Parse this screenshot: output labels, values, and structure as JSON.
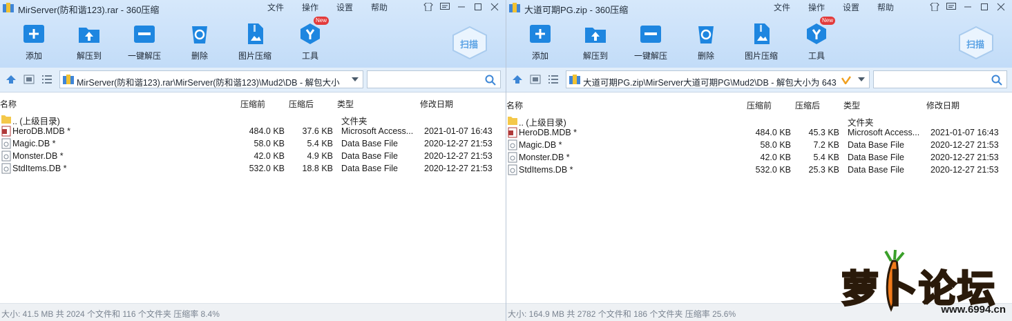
{
  "left": {
    "title": "MirServer(防和谐123).rar - 360压缩",
    "menu": [
      "文件",
      "操作",
      "设置",
      "帮助"
    ],
    "toolbar": {
      "add": "添加",
      "extract_to": "解压到",
      "one_click": "一键解压",
      "delete": "删除",
      "image_compress": "图片压缩",
      "tools": "工具",
      "new_badge": "New",
      "scan": "扫描"
    },
    "path": "MirServer(防和谐123).rar\\MirServer(防和谐123)\\Mud2\\DB - 解包大小",
    "columns": {
      "name": "名称",
      "before": "压缩前",
      "after": "压缩后",
      "type": "类型",
      "modified": "修改日期"
    },
    "parent": {
      "name": ".. (上级目录)",
      "type": "文件夹"
    },
    "files": [
      {
        "name": "HeroDB.MDB *",
        "before": "484.0 KB",
        "after": "37.6 KB",
        "type": "Microsoft Access...",
        "modified": "2021-01-07 16:43"
      },
      {
        "name": "Magic.DB *",
        "before": "58.0 KB",
        "after": "5.4 KB",
        "type": "Data Base File",
        "modified": "2020-12-27 21:53"
      },
      {
        "name": "Monster.DB *",
        "before": "42.0 KB",
        "after": "4.9 KB",
        "type": "Data Base File",
        "modified": "2020-12-27 21:53"
      },
      {
        "name": "StdItems.DB *",
        "before": "532.0 KB",
        "after": "18.8 KB",
        "type": "Data Base File",
        "modified": "2020-12-27 21:53"
      }
    ],
    "status": "大小: 41.5 MB 共 2024 个文件和 116 个文件夹 压缩率 8.4%"
  },
  "right": {
    "title": "大道可期PG.zip - 360压缩",
    "menu": [
      "文件",
      "操作",
      "设置",
      "帮助"
    ],
    "toolbar": {
      "add": "添加",
      "extract_to": "解压到",
      "one_click": "一键解压",
      "delete": "删除",
      "image_compress": "图片压缩",
      "tools": "工具",
      "new_badge": "New",
      "scan": "扫描"
    },
    "path": "大道可期PG.zip\\MirServer大道可期PG\\Mud2\\DB - 解包大小为 643",
    "columns": {
      "name": "名称",
      "before": "压缩前",
      "after": "压缩后",
      "type": "类型",
      "modified": "修改日期"
    },
    "parent": {
      "name": ".. (上级目录)",
      "type": "文件夹"
    },
    "files": [
      {
        "name": "HeroDB.MDB *",
        "before": "484.0 KB",
        "after": "45.3 KB",
        "type": "Microsoft Access...",
        "modified": "2021-01-07 16:43"
      },
      {
        "name": "Magic.DB *",
        "before": "58.0 KB",
        "after": "7.2 KB",
        "type": "Data Base File",
        "modified": "2020-12-27 21:53"
      },
      {
        "name": "Monster.DB *",
        "before": "42.0 KB",
        "after": "5.4 KB",
        "type": "Data Base File",
        "modified": "2020-12-27 21:53"
      },
      {
        "name": "StdItems.DB *",
        "before": "532.0 KB",
        "after": "25.3 KB",
        "type": "Data Base File",
        "modified": "2020-12-27 21:53"
      }
    ],
    "status": "大小: 164.9 MB 共 2782 个文件和 186 个文件夹 压缩率 25.6%"
  },
  "watermark": {
    "brand": "萝卜论坛",
    "url": "www.6994.cn"
  },
  "colors": {
    "accent": "#1e86e0",
    "toolbar_bg": "#cfe4fa",
    "new_badge": "#e33b3b"
  }
}
